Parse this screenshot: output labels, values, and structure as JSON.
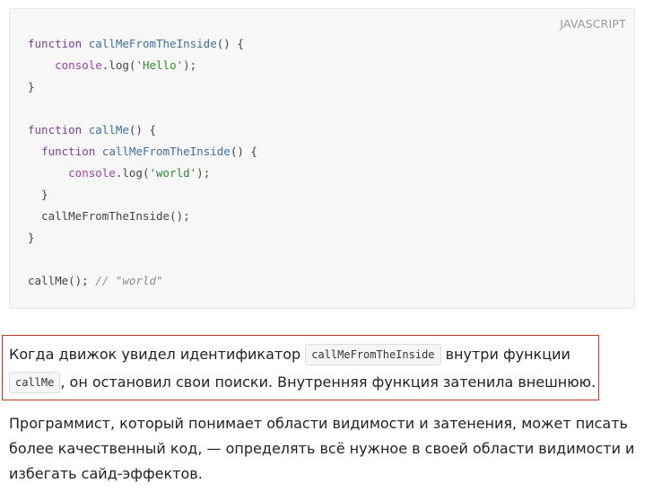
{
  "code_block": {
    "language": "JAVASCRIPT",
    "lines": [
      [
        {
          "t": "function",
          "c": "kw"
        },
        {
          "t": " ",
          "c": "plain"
        },
        {
          "t": "callMeFromTheInside",
          "c": "fn"
        },
        {
          "t": "() {",
          "c": "plain"
        }
      ],
      [
        {
          "t": "    ",
          "c": "plain"
        },
        {
          "t": "console",
          "c": "obj"
        },
        {
          "t": ".log(",
          "c": "plain"
        },
        {
          "t": "'Hello'",
          "c": "str"
        },
        {
          "t": ");",
          "c": "plain"
        }
      ],
      [
        {
          "t": "}",
          "c": "plain"
        }
      ],
      [],
      [
        {
          "t": "function",
          "c": "kw"
        },
        {
          "t": " ",
          "c": "plain"
        },
        {
          "t": "callMe",
          "c": "fn"
        },
        {
          "t": "() {",
          "c": "plain"
        }
      ],
      [
        {
          "t": "  ",
          "c": "plain"
        },
        {
          "t": "function",
          "c": "kw"
        },
        {
          "t": " ",
          "c": "plain"
        },
        {
          "t": "callMeFromTheInside",
          "c": "fn"
        },
        {
          "t": "() {",
          "c": "plain"
        }
      ],
      [
        {
          "t": "      ",
          "c": "plain"
        },
        {
          "t": "console",
          "c": "obj"
        },
        {
          "t": ".log(",
          "c": "plain"
        },
        {
          "t": "'world'",
          "c": "str"
        },
        {
          "t": ");",
          "c": "plain"
        }
      ],
      [
        {
          "t": "  }",
          "c": "plain"
        }
      ],
      [
        {
          "t": "  callMeFromTheInside();",
          "c": "plain"
        }
      ],
      [
        {
          "t": "}",
          "c": "plain"
        }
      ],
      [],
      [
        {
          "t": "callMe(); ",
          "c": "plain"
        },
        {
          "t": "// \"world\"",
          "c": "cmt"
        }
      ]
    ]
  },
  "paragraph1": {
    "text_a": "Когда движок увидел идентификатор ",
    "code_a": "callMeFromTheInside",
    "text_b": " внутри функции ",
    "code_b": "callMe",
    "text_c": ", он остановил свои поиски. Внутренняя функция затенила внешнюю."
  },
  "paragraph2": {
    "text": "Программист, который понимает области видимости и затенения, может писать более качественный код, — определять всё нужное в своей области видимости и избегать сайд-эффектов."
  }
}
